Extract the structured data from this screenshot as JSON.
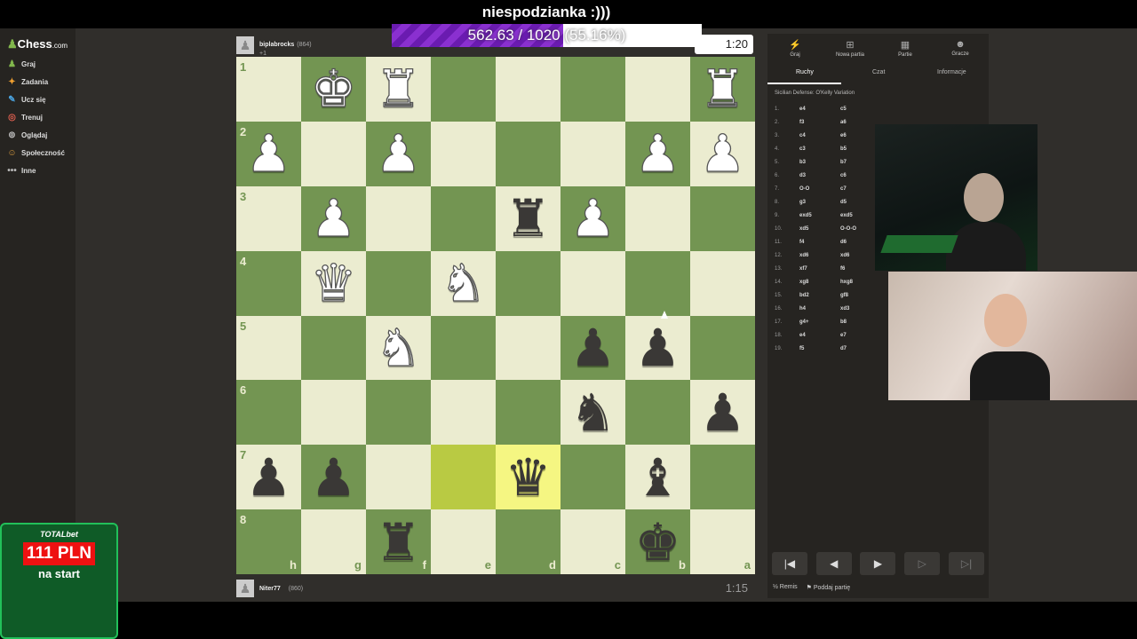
{
  "overlay": {
    "title": "niespodzianka :)))",
    "goal_text": "562.63 / 1020 (55.16%)",
    "goal_fraction": 0.5516
  },
  "sidebar": {
    "brand": "Chess",
    "brand_suffix": ".com",
    "items": [
      {
        "label": "Graj",
        "icon": "pawn-icon"
      },
      {
        "label": "Zadania",
        "icon": "puzzle-icon"
      },
      {
        "label": "Ucz się",
        "icon": "lesson-icon"
      },
      {
        "label": "Trenuj",
        "icon": "target-icon"
      },
      {
        "label": "Oglądaj",
        "icon": "binoculars-icon"
      },
      {
        "label": "Społeczność",
        "icon": "community-icon"
      },
      {
        "label": "Inne",
        "icon": "more-icon"
      }
    ]
  },
  "top_player": {
    "name": "biplabrocks",
    "rating": "(864)",
    "material": "+1",
    "clock": "1:20"
  },
  "bottom_player": {
    "name": "Niter77",
    "rating": "(860)",
    "clock": "1:15"
  },
  "board": {
    "ranks": [
      "1",
      "2",
      "3",
      "4",
      "5",
      "6",
      "7",
      "8"
    ],
    "files": [
      "h",
      "g",
      "f",
      "e",
      "d",
      "c",
      "b",
      "a"
    ],
    "rows": [
      [
        "",
        "wK",
        "wR",
        "",
        "",
        "",
        "",
        "wR"
      ],
      [
        "wP",
        "",
        "wP",
        "",
        "",
        "",
        "wP",
        "wP"
      ],
      [
        "",
        "wP",
        "",
        "",
        "bR",
        "wP",
        "",
        ""
      ],
      [
        "",
        "wQ",
        "",
        "wN",
        "",
        "",
        "",
        ""
      ],
      [
        "",
        "",
        "wN",
        "",
        "",
        "bP",
        "bP",
        ""
      ],
      [
        "",
        "",
        "",
        "",
        "",
        "bN",
        "",
        "bP"
      ],
      [
        "bP",
        "bP",
        "",
        "HL",
        "bQ",
        "",
        "bB",
        ""
      ],
      [
        "",
        "",
        "bR",
        "",
        "",
        "",
        "bK",
        ""
      ]
    ],
    "highlights": [
      [
        6,
        3
      ],
      [
        6,
        4
      ]
    ]
  },
  "panel": {
    "tabs": [
      {
        "label": "Graj",
        "icon": "lightning-icon"
      },
      {
        "label": "Nowa partia",
        "icon": "plus-icon"
      },
      {
        "label": "Partie",
        "icon": "grid-icon"
      },
      {
        "label": "Gracze",
        "icon": "players-icon"
      }
    ],
    "subtabs": [
      "Ruchy",
      "Czat",
      "Informacje"
    ],
    "opening": "Sicilian Defense: O'Kelly Variation",
    "moves": [
      [
        "1.",
        "e4",
        "c5"
      ],
      [
        "2.",
        "f3",
        "a6"
      ],
      [
        "3.",
        "c4",
        "e6"
      ],
      [
        "4.",
        "c3",
        "b5"
      ],
      [
        "5.",
        "b3",
        "b7"
      ],
      [
        "6.",
        "d3",
        "c6"
      ],
      [
        "7.",
        "O-O",
        "c7"
      ],
      [
        "8.",
        "g3",
        "d5"
      ],
      [
        "9.",
        "exd5",
        "exd5"
      ],
      [
        "10.",
        "xd5",
        "O-O-O"
      ],
      [
        "11.",
        "f4",
        "d6"
      ],
      [
        "12.",
        "xd6",
        "xd6"
      ],
      [
        "13.",
        "xf7",
        "f6"
      ],
      [
        "14.",
        "xg8",
        "hxg8"
      ],
      [
        "15.",
        "bd2",
        "gf8"
      ],
      [
        "16.",
        "h4",
        "xd3"
      ],
      [
        "17.",
        "g4+",
        "b8"
      ],
      [
        "18.",
        "e4",
        "e7"
      ],
      [
        "19.",
        "f5",
        "d7"
      ]
    ],
    "actions": {
      "draw": "Remis",
      "resign": "Poddaj partię"
    }
  },
  "promo": {
    "brand": "TOTALbet",
    "amount": "111 PLN",
    "sub": "na start"
  }
}
